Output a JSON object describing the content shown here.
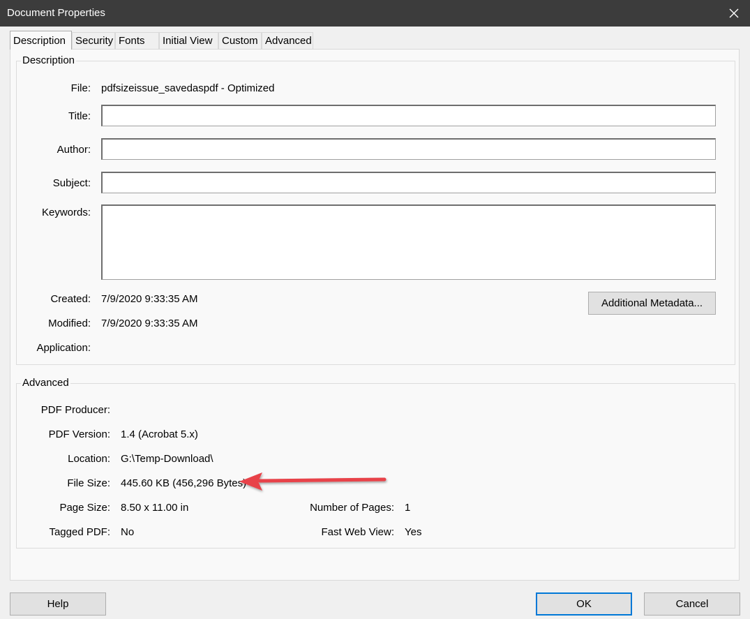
{
  "window": {
    "title": "Document Properties"
  },
  "tabs": [
    "Description",
    "Security",
    "Fonts",
    "Initial View",
    "Custom",
    "Advanced"
  ],
  "description": {
    "group_title": "Description",
    "file_label": "File:",
    "file_value": "pdfsizeissue_savedaspdf - Optimized",
    "title_label": "Title:",
    "title_value": "",
    "author_label": "Author:",
    "author_value": "",
    "subject_label": "Subject:",
    "subject_value": "",
    "keywords_label": "Keywords:",
    "keywords_value": "",
    "created_label": "Created:",
    "created_value": "7/9/2020 9:33:35 AM",
    "modified_label": "Modified:",
    "modified_value": "7/9/2020 9:33:35 AM",
    "application_label": "Application:",
    "application_value": "",
    "metadata_button": "Additional Metadata..."
  },
  "advanced": {
    "group_title": "Advanced",
    "producer_label": "PDF Producer:",
    "producer_value": "",
    "version_label": "PDF Version:",
    "version_value": "1.4 (Acrobat 5.x)",
    "location_label": "Location:",
    "location_value": "G:\\Temp-Download\\",
    "filesize_label": "File Size:",
    "filesize_value": "445.60 KB (456,296 Bytes)",
    "pagesize_label": "Page Size:",
    "pagesize_value": "8.50 x 11.00 in",
    "numpages_label": "Number of Pages:",
    "numpages_value": "1",
    "tagged_label": "Tagged PDF:",
    "tagged_value": "No",
    "fastweb_label": "Fast Web View:",
    "fastweb_value": "Yes"
  },
  "footer": {
    "help": "Help",
    "ok": "OK",
    "cancel": "Cancel"
  },
  "colors": {
    "titlebar": "#3c3c3c",
    "annotation_arrow": "#e8434a",
    "default_button_border": "#0078d7"
  },
  "icons": {
    "close": "close-icon",
    "arrow": "annotation-arrow"
  }
}
